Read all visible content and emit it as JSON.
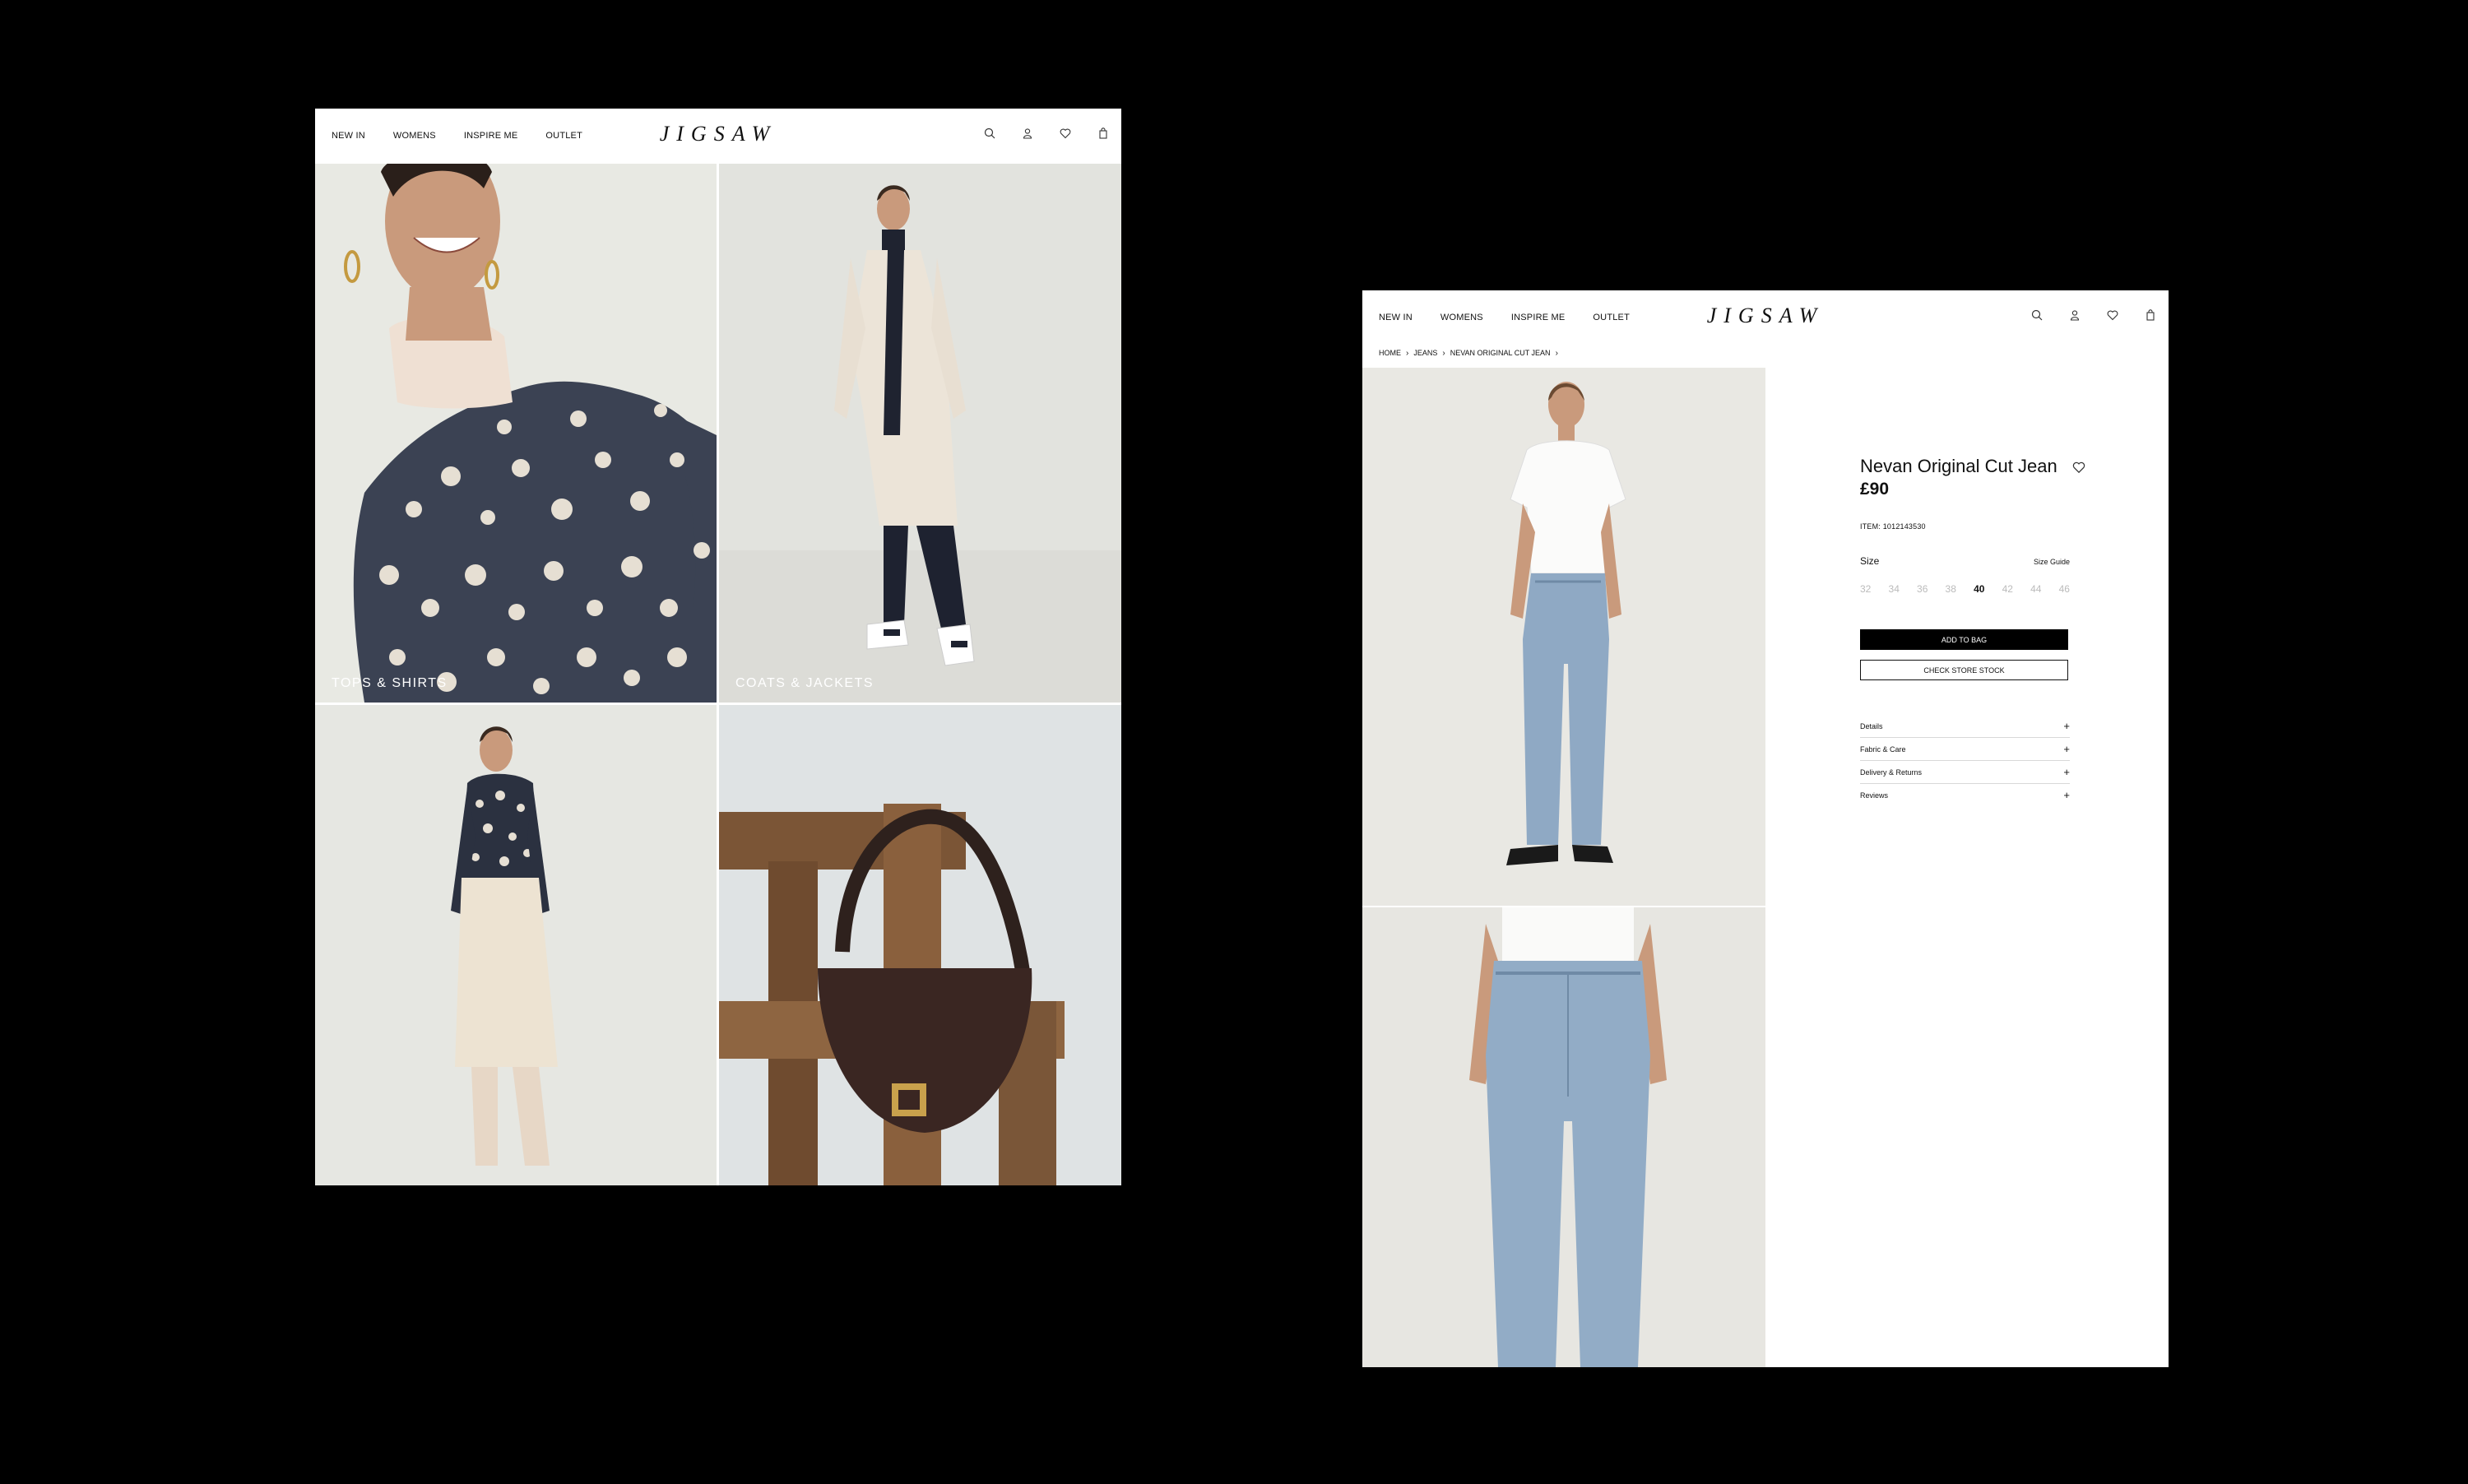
{
  "nav": {
    "items": [
      "NEW IN",
      "WOMENS",
      "INSPIRE ME",
      "OUTLET"
    ],
    "logo": "JIGSAW",
    "icons": [
      "search-icon",
      "account-icon",
      "wishlist-heart-icon",
      "bag-icon"
    ]
  },
  "home": {
    "tiles": [
      {
        "label": "TOPS & SHIRTS"
      },
      {
        "label": "COATS & JACKETS"
      },
      {
        "label": ""
      },
      {
        "label": ""
      }
    ]
  },
  "product": {
    "breadcrumb": [
      "HOME",
      "JEANS",
      "NEVAN ORIGINAL CUT JEAN"
    ],
    "name": "Nevan Original Cut Jean",
    "price": "£90",
    "item_code": "ITEM: 1012143530",
    "size_label": "Size",
    "size_guide": "Size Guide",
    "sizes": [
      "32",
      "34",
      "36",
      "38",
      "40",
      "42",
      "44",
      "46"
    ],
    "selected_size": "40",
    "add_to_bag": "ADD TO BAG",
    "check_stock": "CHECK STORE STOCK",
    "accordion": [
      "Details",
      "Fabric & Care",
      "Delivery & Returns",
      "Reviews"
    ]
  },
  "colors": {
    "background": "#000000",
    "page": "#ffffff",
    "button_primary": "#000000"
  }
}
